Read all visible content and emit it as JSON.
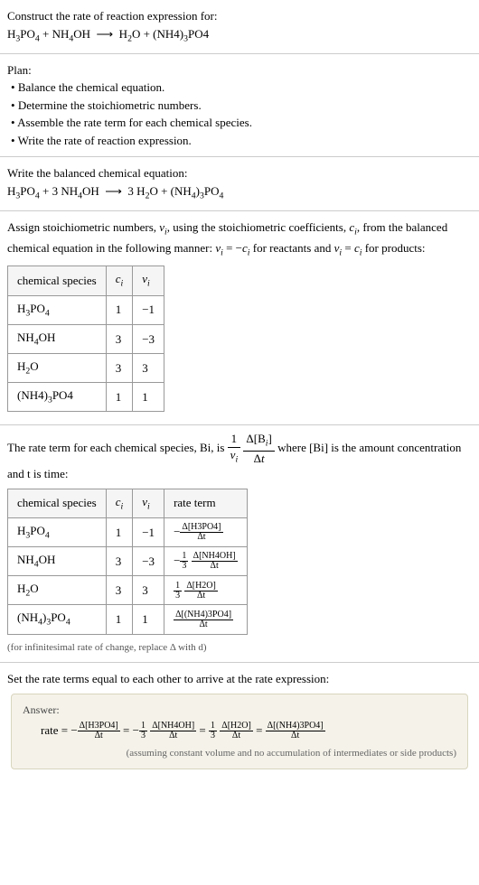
{
  "header": {
    "prompt": "Construct the rate of reaction expression for:",
    "equation_text": "H3PO4 + NH4OH ⟶ H2O + (NH4)3PO4"
  },
  "plan": {
    "title": "Plan:",
    "steps": [
      "Balance the chemical equation.",
      "Determine the stoichiometric numbers.",
      "Assemble the rate term for each chemical species.",
      "Write the rate of reaction expression."
    ]
  },
  "balanced": {
    "title": "Write the balanced chemical equation:",
    "equation_text": "H3PO4 + 3 NH4OH ⟶ 3 H2O + (NH4)3PO4"
  },
  "stoich": {
    "intro": "Assign stoichiometric numbers, νi, using the stoichiometric coefficients, ci, from the balanced chemical equation in the following manner: νi = −ci for reactants and νi = ci for products:",
    "headers": {
      "species": "chemical species",
      "ci": "ci",
      "vi": "νi"
    },
    "rows": [
      {
        "species": "H3PO4",
        "ci": "1",
        "vi": "−1"
      },
      {
        "species": "NH4OH",
        "ci": "3",
        "vi": "−3"
      },
      {
        "species": "H2O",
        "ci": "3",
        "vi": "3"
      },
      {
        "species": "(NH4)3PO4",
        "ci": "1",
        "vi": "1"
      }
    ]
  },
  "rateterm": {
    "intro_before": "The rate term for each chemical species, Bi, is ",
    "intro_after": " where [Bi] is the amount concentration and t is time:",
    "headers": {
      "species": "chemical species",
      "ci": "ci",
      "vi": "νi",
      "rate": "rate term"
    },
    "rows": [
      {
        "species": "H3PO4",
        "ci": "1",
        "vi": "−1",
        "num": "Δ[H3PO4]",
        "den": "Δt",
        "coef": "−"
      },
      {
        "species": "NH4OH",
        "ci": "3",
        "vi": "−3",
        "num": "Δ[NH4OH]",
        "den": "Δt",
        "coef": "−⅓·"
      },
      {
        "species": "H2O",
        "ci": "3",
        "vi": "3",
        "num": "Δ[H2O]",
        "den": "Δt",
        "coef": "⅓·"
      },
      {
        "species": "(NH4)3PO4",
        "ci": "1",
        "vi": "1",
        "num": "Δ[(NH4)3PO4]",
        "den": "Δt",
        "coef": ""
      }
    ],
    "footnote": "(for infinitesimal rate of change, replace Δ with d)"
  },
  "final": {
    "title": "Set the rate terms equal to each other to arrive at the rate expression:"
  },
  "answer": {
    "title": "Answer:",
    "prefix": "rate = ",
    "terms": [
      {
        "sign": "−",
        "coef_num": "",
        "coef_den": "",
        "num": "Δ[H3PO4]",
        "den": "Δt"
      },
      {
        "sign": "−",
        "coef_num": "1",
        "coef_den": "3",
        "num": "Δ[NH4OH]",
        "den": "Δt"
      },
      {
        "sign": "",
        "coef_num": "1",
        "coef_den": "3",
        "num": "Δ[H2O]",
        "den": "Δt"
      },
      {
        "sign": "",
        "coef_num": "",
        "coef_den": "",
        "num": "Δ[(NH4)3PO4]",
        "den": "Δt"
      }
    ],
    "assumption": "(assuming constant volume and no accumulation of intermediates or side products)"
  }
}
